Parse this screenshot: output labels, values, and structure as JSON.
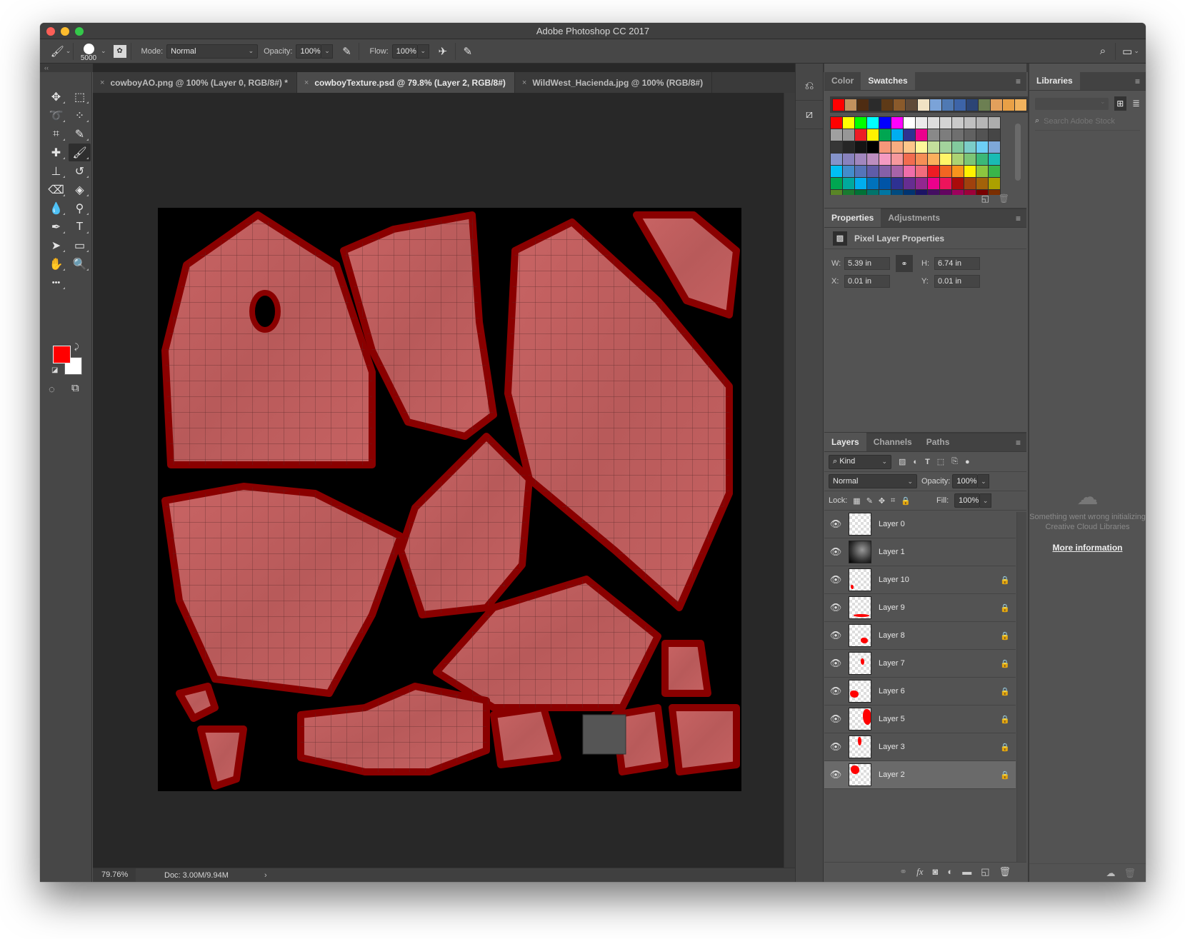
{
  "window": {
    "title": "Adobe Photoshop CC 2017"
  },
  "options_bar": {
    "brush_size": "5000",
    "mode_label": "Mode:",
    "mode_value": "Normal",
    "opacity_label": "Opacity:",
    "opacity_value": "100%",
    "flow_label": "Flow:",
    "flow_value": "100%"
  },
  "tools": [
    {
      "name": "move-tool",
      "glyph": "✥"
    },
    {
      "name": "marquee-tool",
      "glyph": "⬚"
    },
    {
      "name": "lasso-tool",
      "glyph": "➰"
    },
    {
      "name": "quick-selection-tool",
      "glyph": "⁘"
    },
    {
      "name": "crop-tool",
      "glyph": "⌗"
    },
    {
      "name": "eyedropper-tool",
      "glyph": "✎"
    },
    {
      "name": "healing-brush-tool",
      "glyph": "✚"
    },
    {
      "name": "brush-tool",
      "glyph": "🖌",
      "active": true
    },
    {
      "name": "clone-stamp-tool",
      "glyph": "⊥"
    },
    {
      "name": "history-brush-tool",
      "glyph": "↺"
    },
    {
      "name": "eraser-tool",
      "glyph": "⌫"
    },
    {
      "name": "paint-bucket-tool",
      "glyph": "◈"
    },
    {
      "name": "blur-tool",
      "glyph": "💧"
    },
    {
      "name": "dodge-tool",
      "glyph": "⚲"
    },
    {
      "name": "pen-tool",
      "glyph": "✒"
    },
    {
      "name": "type-tool",
      "glyph": "T"
    },
    {
      "name": "path-selection-tool",
      "glyph": "➤"
    },
    {
      "name": "rectangle-tool",
      "glyph": "▭"
    },
    {
      "name": "hand-tool",
      "glyph": "✋"
    },
    {
      "name": "zoom-tool",
      "glyph": "🔍"
    },
    {
      "name": "more-tools",
      "glyph": "•••"
    }
  ],
  "colors": {
    "foreground": "#ff0000",
    "background": "#ffffff"
  },
  "document_tabs": [
    {
      "label": "cowboyAO.png @ 100% (Layer 0, RGB/8#) *",
      "active": false
    },
    {
      "label": "cowboyTexture.psd @ 79.8% (Layer 2, RGB/8#)",
      "active": true
    },
    {
      "label": "WildWest_Hacienda.jpg @ 100% (RGB/8#)",
      "active": false
    }
  ],
  "status_bar": {
    "zoom": "79.76%",
    "doc": "Doc: 3.00M/9.94M"
  },
  "swatches_panel": {
    "tabs": [
      "Color",
      "Swatches"
    ],
    "active_tab": "Swatches",
    "recent": [
      "#ff0000",
      "#c2915e",
      "#4e2c12",
      "#2b2b2b",
      "#5e3a17",
      "#8a5a2b",
      "#5f4a39",
      "#f1e2c4",
      "#7ba3d8",
      "#4f79b3",
      "#3d64a8",
      "#2c4575",
      "#6c7f52",
      "#e3a05c",
      "#e9a046",
      "#f1b25d"
    ],
    "rows": [
      [
        "#ff0000",
        "#ffff00",
        "#00ff00",
        "#00ffff",
        "#0000ff",
        "#ff00ff",
        "#ffffff",
        "#ebebeb",
        "#dedede",
        "#d4d4d4",
        "#cacaca",
        "#c0c0c0",
        "#b6b6b6",
        "#acacac"
      ],
      [
        "#a0a0a0",
        "#979797",
        "#ed1c24",
        "#fff200",
        "#00a651",
        "#00aeef",
        "#2e3192",
        "#ec008c",
        "#898989",
        "#7d7d7d",
        "#6f6f6f",
        "#616161",
        "#535353",
        "#464646"
      ],
      [
        "#363636",
        "#262626",
        "#141414",
        "#000000",
        "#f7977a",
        "#f9ad81",
        "#fdc68a",
        "#fff79a",
        "#c4df9b",
        "#a3d39c",
        "#82ca9d",
        "#7bcdc8",
        "#6dcff6",
        "#7ea7d8"
      ],
      [
        "#8493ca",
        "#8882be",
        "#a186be",
        "#bc8dbf",
        "#f49ac2",
        "#f6989d",
        "#f26c4f",
        "#f68e56",
        "#fbaf5d",
        "#fff568",
        "#acd373",
        "#7cc576",
        "#3bb878",
        "#1abbb4"
      ],
      [
        "#00bff3",
        "#438ccb",
        "#5574b9",
        "#605ca8",
        "#8560a8",
        "#a863a8",
        "#f06eaa",
        "#f26d7d",
        "#ed1c24",
        "#f26522",
        "#f7941d",
        "#fff200",
        "#8dc63f",
        "#39b54a"
      ],
      [
        "#00a651",
        "#00a99d",
        "#00aeef",
        "#0072bc",
        "#0054a6",
        "#2e3192",
        "#662d91",
        "#92278f",
        "#ec008c",
        "#ed145b",
        "#aa0b0b",
        "#a0410d",
        "#a36209",
        "#aba000"
      ],
      [
        "#598527",
        "#197b30",
        "#007236",
        "#00746b",
        "#0076a3",
        "#004b80",
        "#003471",
        "#1b1464",
        "#440e62",
        "#630460",
        "#9e005d",
        "#9e0039",
        "#790000",
        "#7b2e00"
      ]
    ]
  },
  "properties_panel": {
    "tabs": [
      "Properties",
      "Adjustments"
    ],
    "active_tab": "Properties",
    "heading": "Pixel Layer Properties",
    "w_label": "W:",
    "w_value": "5.39 in",
    "h_label": "H:",
    "h_value": "6.74 in",
    "x_label": "X:",
    "x_value": "0.01 in",
    "y_label": "Y:",
    "y_value": "0.01 in"
  },
  "layers_panel": {
    "tabs": [
      "Layers",
      "Channels",
      "Paths"
    ],
    "active_tab": "Layers",
    "filter_label": "Kind",
    "blend_mode": "Normal",
    "opacity_label": "Opacity:",
    "opacity_value": "100%",
    "lock_label": "Lock:",
    "fill_label": "Fill:",
    "fill_value": "100%",
    "layers": [
      {
        "name": "Layer 0",
        "locked": false,
        "selected": false
      },
      {
        "name": "Layer 1",
        "locked": false,
        "selected": false
      },
      {
        "name": "Layer 10",
        "locked": true,
        "selected": false
      },
      {
        "name": "Layer 9",
        "locked": true,
        "selected": false
      },
      {
        "name": "Layer 8",
        "locked": true,
        "selected": false
      },
      {
        "name": "Layer 7",
        "locked": true,
        "selected": false
      },
      {
        "name": "Layer 6",
        "locked": true,
        "selected": false
      },
      {
        "name": "Layer 5",
        "locked": true,
        "selected": false
      },
      {
        "name": "Layer 3",
        "locked": true,
        "selected": false
      },
      {
        "name": "Layer 2",
        "locked": true,
        "selected": true
      }
    ]
  },
  "libraries_panel": {
    "tab": "Libraries",
    "search_placeholder": "Search Adobe Stock",
    "error_line1": "Something went wrong initializing",
    "error_line2": "Creative Cloud Libraries",
    "more_info": "More information"
  }
}
